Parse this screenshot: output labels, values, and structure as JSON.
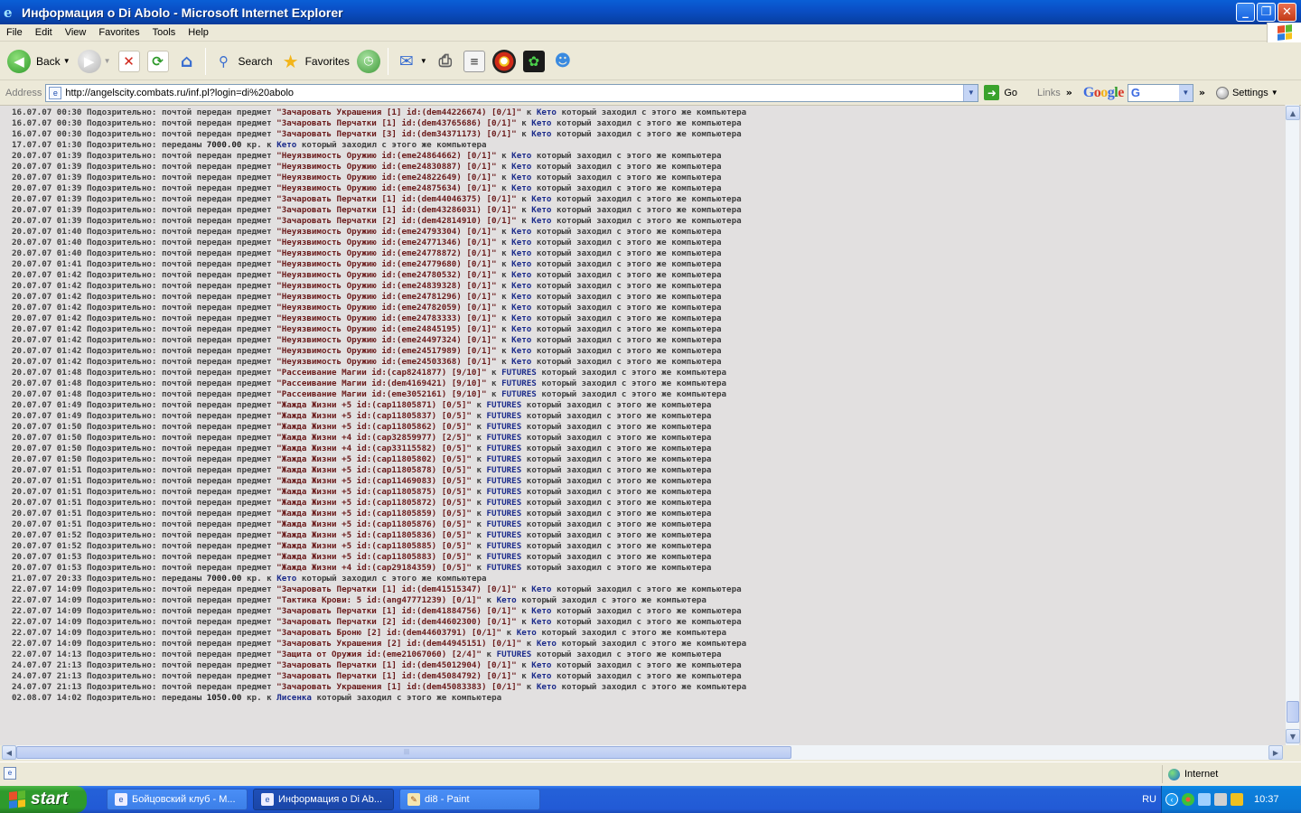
{
  "window": {
    "title": "Информация о Di Abolo - Microsoft Internet Explorer"
  },
  "menu": [
    "File",
    "Edit",
    "View",
    "Favorites",
    "Tools",
    "Help"
  ],
  "toolbar": {
    "back": "Back",
    "search": "Search",
    "favorites": "Favorites"
  },
  "address": {
    "label": "Address",
    "url": "http://angelscity.combats.ru/inf.pl?login=di%20abolo",
    "go": "Go",
    "links": "Links",
    "google": "Google",
    "settings": "Settings"
  },
  "log": [
    [
      "16.07.07 00:30 Подозрительно: почтой передан предмет ",
      "\"Зачаровать Украшения [1] id:(dem44226674) [0/1]\"",
      " к ",
      "Кето",
      " который заходил с этого же компьютера"
    ],
    [
      "16.07.07 00:30 Подозрительно: почтой передан предмет ",
      "\"Зачаровать Перчатки [1] id:(dem43765686) [0/1]\"",
      " к ",
      "Кето",
      " который заходил с этого же компьютера"
    ],
    [
      "16.07.07 00:30 Подозрительно: почтой передан предмет ",
      "\"Зачаровать Перчатки [3] id:(dem34371173) [0/1]\"",
      " к ",
      "Кето",
      " который заходил с этого же компьютера"
    ],
    [
      "17.07.07 01:30 Подозрительно: переданы ",
      "7000.00",
      " кр. к ",
      "Кето",
      " который заходил с этого же компьютера"
    ],
    [
      "20.07.07 01:39 Подозрительно: почтой передан предмет ",
      "\"Неуязвимость Оружию id:(eme24864662) [0/1]\"",
      " к ",
      "Кето",
      " который заходил с этого же компьютера"
    ],
    [
      "20.07.07 01:39 Подозрительно: почтой передан предмет ",
      "\"Неуязвимость Оружию id:(eme24830887) [0/1]\"",
      " к ",
      "Кето",
      " который заходил с этого же компьютера"
    ],
    [
      "20.07.07 01:39 Подозрительно: почтой передан предмет ",
      "\"Неуязвимость Оружию id:(eme24822649) [0/1]\"",
      " к ",
      "Кето",
      " который заходил с этого же компьютера"
    ],
    [
      "20.07.07 01:39 Подозрительно: почтой передан предмет ",
      "\"Неуязвимость Оружию id:(eme24875634) [0/1]\"",
      " к ",
      "Кето",
      " который заходил с этого же компьютера"
    ],
    [
      "20.07.07 01:39 Подозрительно: почтой передан предмет ",
      "\"Зачаровать Перчатки [1] id:(dem44046375) [0/1]\"",
      " к ",
      "Кето",
      " который заходил с этого же компьютера"
    ],
    [
      "20.07.07 01:39 Подозрительно: почтой передан предмет ",
      "\"Зачаровать Перчатки [1] id:(dem43286031) [0/1]\"",
      " к ",
      "Кето",
      " который заходил с этого же компьютера"
    ],
    [
      "20.07.07 01:39 Подозрительно: почтой передан предмет ",
      "\"Зачаровать Перчатки [2] id:(dem42814910) [0/1]\"",
      " к ",
      "Кето",
      " который заходил с этого же компьютера"
    ],
    [
      "20.07.07 01:40 Подозрительно: почтой передан предмет ",
      "\"Неуязвимость Оружию id:(eme24793304) [0/1]\"",
      " к ",
      "Кето",
      " который заходил с этого же компьютера"
    ],
    [
      "20.07.07 01:40 Подозрительно: почтой передан предмет ",
      "\"Неуязвимость Оружию id:(eme24771346) [0/1]\"",
      " к ",
      "Кето",
      " который заходил с этого же компьютера"
    ],
    [
      "20.07.07 01:40 Подозрительно: почтой передан предмет ",
      "\"Неуязвимость Оружию id:(eme24778872) [0/1]\"",
      " к ",
      "Кето",
      " который заходил с этого же компьютера"
    ],
    [
      "20.07.07 01:41 Подозрительно: почтой передан предмет ",
      "\"Неуязвимость Оружию id:(eme24779680) [0/1]\"",
      " к ",
      "Кето",
      " который заходил с этого же компьютера"
    ],
    [
      "20.07.07 01:42 Подозрительно: почтой передан предмет ",
      "\"Неуязвимость Оружию id:(eme24780532) [0/1]\"",
      " к ",
      "Кето",
      " который заходил с этого же компьютера"
    ],
    [
      "20.07.07 01:42 Подозрительно: почтой передан предмет ",
      "\"Неуязвимость Оружию id:(eme24839328) [0/1]\"",
      " к ",
      "Кето",
      " который заходил с этого же компьютера"
    ],
    [
      "20.07.07 01:42 Подозрительно: почтой передан предмет ",
      "\"Неуязвимость Оружию id:(eme24781296) [0/1]\"",
      " к ",
      "Кето",
      " который заходил с этого же компьютера"
    ],
    [
      "20.07.07 01:42 Подозрительно: почтой передан предмет ",
      "\"Неуязвимость Оружию id:(eme24782059) [0/1]\"",
      " к ",
      "Кето",
      " который заходил с этого же компьютера"
    ],
    [
      "20.07.07 01:42 Подозрительно: почтой передан предмет ",
      "\"Неуязвимость Оружию id:(eme24783333) [0/1]\"",
      " к ",
      "Кето",
      " который заходил с этого же компьютера"
    ],
    [
      "20.07.07 01:42 Подозрительно: почтой передан предмет ",
      "\"Неуязвимость Оружию id:(eme24845195) [0/1]\"",
      " к ",
      "Кето",
      " который заходил с этого же компьютера"
    ],
    [
      "20.07.07 01:42 Подозрительно: почтой передан предмет ",
      "\"Неуязвимость Оружию id:(eme24497324) [0/1]\"",
      " к ",
      "Кето",
      " который заходил с этого же компьютера"
    ],
    [
      "20.07.07 01:42 Подозрительно: почтой передан предмет ",
      "\"Неуязвимость Оружию id:(eme24517989) [0/1]\"",
      " к ",
      "Кето",
      " который заходил с этого же компьютера"
    ],
    [
      "20.07.07 01:42 Подозрительно: почтой передан предмет ",
      "\"Неуязвимость Оружию id:(eme24503368) [0/1]\"",
      " к ",
      "Кето",
      " который заходил с этого же компьютера"
    ],
    [
      "20.07.07 01:48 Подозрительно: почтой передан предмет ",
      "\"Рассеивание Магии id:(cap8241877) [9/10]\"",
      " к ",
      "FUTURES",
      " который заходил с этого же компьютера"
    ],
    [
      "20.07.07 01:48 Подозрительно: почтой передан предмет ",
      "\"Рассеивание Магии id:(dem4169421) [9/10]\"",
      " к ",
      "FUTURES",
      " который заходил с этого же компьютера"
    ],
    [
      "20.07.07 01:48 Подозрительно: почтой передан предмет ",
      "\"Рассеивание Магии id:(eme3052161) [9/10]\"",
      " к ",
      "FUTURES",
      " который заходил с этого же компьютера"
    ],
    [
      "20.07.07 01:49 Подозрительно: почтой передан предмет ",
      "\"Жажда Жизни +5 id:(cap11805871) [0/5]\"",
      " к ",
      "FUTURES",
      " который заходил с этого же компьютера"
    ],
    [
      "20.07.07 01:49 Подозрительно: почтой передан предмет ",
      "\"Жажда Жизни +5 id:(cap11805837) [0/5]\"",
      " к ",
      "FUTURES",
      " который заходил с этого же компьютера"
    ],
    [
      "20.07.07 01:50 Подозрительно: почтой передан предмет ",
      "\"Жажда Жизни +5 id:(cap11805862) [0/5]\"",
      " к ",
      "FUTURES",
      " который заходил с этого же компьютера"
    ],
    [
      "20.07.07 01:50 Подозрительно: почтой передан предмет ",
      "\"Жажда Жизни +4 id:(cap32859977) [2/5]\"",
      " к ",
      "FUTURES",
      " который заходил с этого же компьютера"
    ],
    [
      "20.07.07 01:50 Подозрительно: почтой передан предмет ",
      "\"Жажда Жизни +4 id:(cap33115582) [0/5]\"",
      " к ",
      "FUTURES",
      " который заходил с этого же компьютера"
    ],
    [
      "20.07.07 01:50 Подозрительно: почтой передан предмет ",
      "\"Жажда Жизни +5 id:(cap11805802) [0/5]\"",
      " к ",
      "FUTURES",
      " который заходил с этого же компьютера"
    ],
    [
      "20.07.07 01:51 Подозрительно: почтой передан предмет ",
      "\"Жажда Жизни +5 id:(cap11805878) [0/5]\"",
      " к ",
      "FUTURES",
      " который заходил с этого же компьютера"
    ],
    [
      "20.07.07 01:51 Подозрительно: почтой передан предмет ",
      "\"Жажда Жизни +5 id:(cap11469083) [0/5]\"",
      " к ",
      "FUTURES",
      " который заходил с этого же компьютера"
    ],
    [
      "20.07.07 01:51 Подозрительно: почтой передан предмет ",
      "\"Жажда Жизни +5 id:(cap11805875) [0/5]\"",
      " к ",
      "FUTURES",
      " который заходил с этого же компьютера"
    ],
    [
      "20.07.07 01:51 Подозрительно: почтой передан предмет ",
      "\"Жажда Жизни +5 id:(cap11805872) [0/5]\"",
      " к ",
      "FUTURES",
      " который заходил с этого же компьютера"
    ],
    [
      "20.07.07 01:51 Подозрительно: почтой передан предмет ",
      "\"Жажда Жизни +5 id:(cap11805859) [0/5]\"",
      " к ",
      "FUTURES",
      " который заходил с этого же компьютера"
    ],
    [
      "20.07.07 01:51 Подозрительно: почтой передан предмет ",
      "\"Жажда Жизни +5 id:(cap11805876) [0/5]\"",
      " к ",
      "FUTURES",
      " который заходил с этого же компьютера"
    ],
    [
      "20.07.07 01:52 Подозрительно: почтой передан предмет ",
      "\"Жажда Жизни +5 id:(cap11805836) [0/5]\"",
      " к ",
      "FUTURES",
      " который заходил с этого же компьютера"
    ],
    [
      "20.07.07 01:52 Подозрительно: почтой передан предмет ",
      "\"Жажда Жизни +5 id:(cap11805885) [0/5]\"",
      " к ",
      "FUTURES",
      " который заходил с этого же компьютера"
    ],
    [
      "20.07.07 01:53 Подозрительно: почтой передан предмет ",
      "\"Жажда Жизни +5 id:(cap11805883) [0/5]\"",
      " к ",
      "FUTURES",
      " который заходил с этого же компьютера"
    ],
    [
      "20.07.07 01:53 Подозрительно: почтой передан предмет ",
      "\"Жажда Жизни +4 id:(cap29184359) [0/5]\"",
      " к ",
      "FUTURES",
      " который заходил с этого же компьютера"
    ],
    [
      "21.07.07 20:33 Подозрительно: переданы ",
      "7000.00",
      " кр. к ",
      "Кето",
      " который заходил с этого же компьютера"
    ],
    [
      "22.07.07 14:09 Подозрительно: почтой передан предмет ",
      "\"Зачаровать Перчатки [1] id:(dem41515347) [0/1]\"",
      " к ",
      "Кето",
      " который заходил с этого же компьютера"
    ],
    [
      "22.07.07 14:09 Подозрительно: почтой передан предмет ",
      "\"Тактика Крови: 5 id:(ang47771239) [0/1]\"",
      " к ",
      "Кето",
      " который заходил с этого же компьютера"
    ],
    [
      "22.07.07 14:09 Подозрительно: почтой передан предмет ",
      "\"Зачаровать Перчатки [1] id:(dem41884756) [0/1]\"",
      " к ",
      "Кето",
      " который заходил с этого же компьютера"
    ],
    [
      "22.07.07 14:09 Подозрительно: почтой передан предмет ",
      "\"Зачаровать Перчатки [2] id:(dem44602300) [0/1]\"",
      " к ",
      "Кето",
      " который заходил с этого же компьютера"
    ],
    [
      "22.07.07 14:09 Подозрительно: почтой передан предмет ",
      "\"Зачаровать Броню [2] id:(dem44603791) [0/1]\"",
      " к ",
      "Кето",
      " который заходил с этого же компьютера"
    ],
    [
      "22.07.07 14:09 Подозрительно: почтой передан предмет ",
      "\"Зачаровать Украшения [2] id:(dem44945151) [0/1]\"",
      " к ",
      "Кето",
      " который заходил с этого же компьютера"
    ],
    [
      "22.07.07 14:13 Подозрительно: почтой передан предмет ",
      "\"Защита от Оружия id:(eme21067060) [2/4]\"",
      " к ",
      "FUTURES",
      " который заходил с этого же компьютера"
    ],
    [
      "24.07.07 21:13 Подозрительно: почтой передан предмет ",
      "\"Зачаровать Перчатки [1] id:(dem45012904) [0/1]\"",
      " к ",
      "Кето",
      " который заходил с этого же компьютера"
    ],
    [
      "24.07.07 21:13 Подозрительно: почтой передан предмет ",
      "\"Зачаровать Перчатки [1] id:(dem45084792) [0/1]\"",
      " к ",
      "Кето",
      " который заходил с этого же компьютера"
    ],
    [
      "24.07.07 21:13 Подозрительно: почтой передан предмет ",
      "\"Зачаровать Украшения [1] id:(dem45083383) [0/1]\"",
      " к ",
      "Кето",
      " который заходил с этого же компьютера"
    ],
    [
      "02.08.07 14:02 Подозрительно: переданы ",
      "1050.00",
      " кр. к ",
      "Лисенка",
      " который заходил с этого же компьютера"
    ]
  ],
  "status": {
    "zone": "Internet"
  },
  "taskbar": {
    "start": "start",
    "tasks": [
      "Бойцовский клуб - M...",
      "Информация о Di Ab...",
      "di8 - Paint"
    ],
    "lang": "RU",
    "clock": "10:37"
  }
}
